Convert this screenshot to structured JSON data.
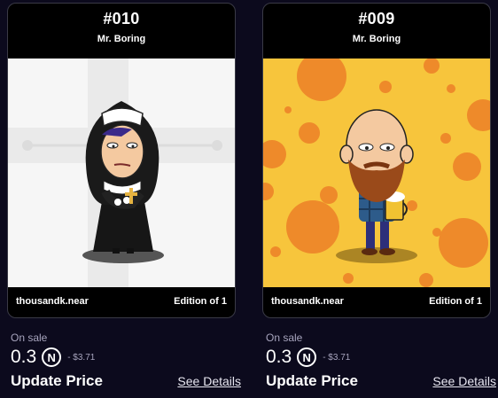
{
  "cards": [
    {
      "number": "#010",
      "collection": "Mr. Boring",
      "owner": "thousandk.near",
      "edition": "Edition of 1",
      "art_description_icon": "nun-character-icon",
      "background": "#f4f4f4"
    },
    {
      "number": "#009",
      "collection": "Mr. Boring",
      "owner": "thousandk.near",
      "edition": "Edition of 1",
      "art_description_icon": "bearded-man-beer-icon",
      "background": "#f7c53c"
    }
  ],
  "sales": [
    {
      "status": "On sale",
      "price": "0.3",
      "currency_glyph": "Ⓝ",
      "usd": "- $3.71",
      "update_label": "Update Price",
      "details_label": "See Details"
    },
    {
      "status": "On sale",
      "price": "0.3",
      "currency_glyph": "Ⓝ",
      "usd": "- $3.71",
      "update_label": "Update Price",
      "details_label": "See Details"
    }
  ],
  "colors": {
    "page_bg": "#0c0a1d",
    "card_bg": "#000000",
    "muted_text": "#a7a4bd",
    "dot_orange": "#ee8a2a"
  }
}
